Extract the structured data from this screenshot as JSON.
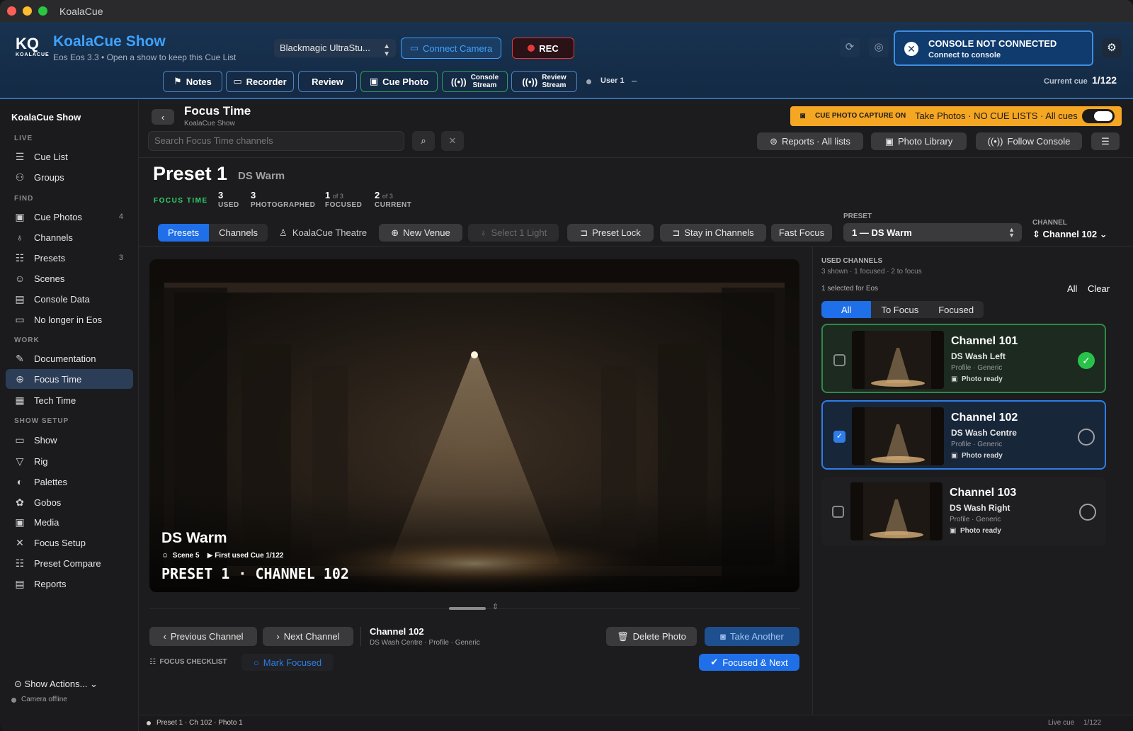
{
  "window": {
    "title": "KoalaCue"
  },
  "header": {
    "logo_text": "KQ",
    "logo_sub": "KOALACUE",
    "app_title": "KoalaCue Show",
    "app_sub": "Eos Eos 3.3  •  Open a show to keep this Cue List",
    "camera_select": "Blackmagic UltraStu...",
    "connect_camera": "Connect Camera",
    "rec": "REC",
    "buttons": {
      "notes": "Notes",
      "recorder": "Recorder",
      "review": "Review",
      "cue_photo": "Cue Photo",
      "console_stream_1": "Console",
      "console_stream_2": "Stream",
      "review_stream_1": "Review",
      "review_stream_2": "Stream"
    },
    "user": "User 1",
    "user_dash": "–",
    "alert_title": "CONSOLE NOT CONNECTED",
    "alert_sub": "Connect to console",
    "current_cue_label": "Current cue",
    "current_cue_value": "1/122"
  },
  "sidebar": {
    "title": "KoalaCue Show",
    "sections": {
      "live": "LIVE",
      "find": "FIND",
      "work": "WORK",
      "show_setup": "SHOW SETUP"
    },
    "items": {
      "cue_list": "Cue List",
      "groups": "Groups",
      "cue_photos": "Cue Photos",
      "cue_photos_count": "4",
      "channels": "Channels",
      "presets": "Presets",
      "presets_count": "3",
      "scenes": "Scenes",
      "console_data": "Console Data",
      "no_longer": "No longer in Eos",
      "documentation": "Documentation",
      "focus_time": "Focus Time",
      "tech_time": "Tech Time",
      "show": "Show",
      "rig": "Rig",
      "palettes": "Palettes",
      "gobos": "Gobos",
      "media": "Media",
      "focus_setup": "Focus Setup",
      "preset_compare": "Preset Compare",
      "reports": "Reports"
    },
    "show_actions": "Show Actions...",
    "camera_status": "Camera offline"
  },
  "page": {
    "title": "Focus Time",
    "subtitle": "KoalaCue Show",
    "capture_label": "CUE PHOTO CAPTURE ON",
    "capture_text": "Take Photos · NO CUE LISTS · All cues",
    "search_placeholder": "Search Focus Time channels",
    "reports_btn": "Reports · All lists",
    "photo_library": "Photo Library",
    "follow_console": "Follow Console"
  },
  "preset": {
    "title": "Preset 1",
    "name": "DS Warm",
    "focus_time_label": "FOCUS TIME",
    "stats": [
      {
        "value": "3",
        "of": "",
        "label": "USED"
      },
      {
        "value": "3",
        "of": "",
        "label": "PHOTOGRAPHED"
      },
      {
        "value": "1",
        "of": "of 3",
        "label": "FOCUSED"
      },
      {
        "value": "2",
        "of": "of 3",
        "label": "CURRENT"
      }
    ]
  },
  "toolbar": {
    "tab_presets": "Presets",
    "tab_channels": "Channels",
    "venue": "KoalaCue Theatre",
    "new_venue": "New Venue",
    "select_light": "Select 1 Light",
    "preset_lock": "Preset Lock",
    "stay_channels": "Stay in Channels",
    "fast_focus": "Fast Focus",
    "preset_label": "PRESET",
    "preset_value": "1 — DS Warm",
    "channel_label": "CHANNEL",
    "channel_value": "Channel 102"
  },
  "photo": {
    "name": "DS Warm",
    "scene": "Scene 5",
    "first_used": "First used Cue 1/122",
    "caption": "PRESET 1 · CHANNEL 102"
  },
  "bottom": {
    "prev": "Previous Channel",
    "next": "Next Channel",
    "ch_name": "Channel 102",
    "ch_detail": "DS Wash Centre · Profile · Generic",
    "delete": "Delete Photo",
    "take_another": "Take Another",
    "checklist": "FOCUS CHECKLIST",
    "mark_focused": "Mark Focused",
    "focused_next": "Focused & Next"
  },
  "used_channels": {
    "title": "USED CHANNELS",
    "summary": "3 shown · 1 focused · 2 to focus",
    "selected": "1 selected for Eos",
    "all": "All",
    "clear": "Clear",
    "filters": [
      "All",
      "To Focus",
      "Focused"
    ],
    "channels": [
      {
        "name": "Channel 101",
        "desc": "DS Wash Left",
        "profile": "Profile · Generic",
        "photo": "Photo ready"
      },
      {
        "name": "Channel 102",
        "desc": "DS Wash Centre",
        "profile": "Profile · Generic",
        "photo": "Photo ready"
      },
      {
        "name": "Channel 103",
        "desc": "DS Wash Right",
        "profile": "Profile · Generic",
        "photo": "Photo ready"
      }
    ]
  },
  "statusbar": {
    "left": "Preset 1 · Ch 102 · Photo 1",
    "live_label": "Live cue",
    "live_value": "1/122"
  },
  "colors": {
    "accent": "#1f6fe8",
    "brand": "#3ea2ff",
    "rec": "#e23b3b",
    "success": "#28c24a",
    "warning": "#f5a623"
  }
}
